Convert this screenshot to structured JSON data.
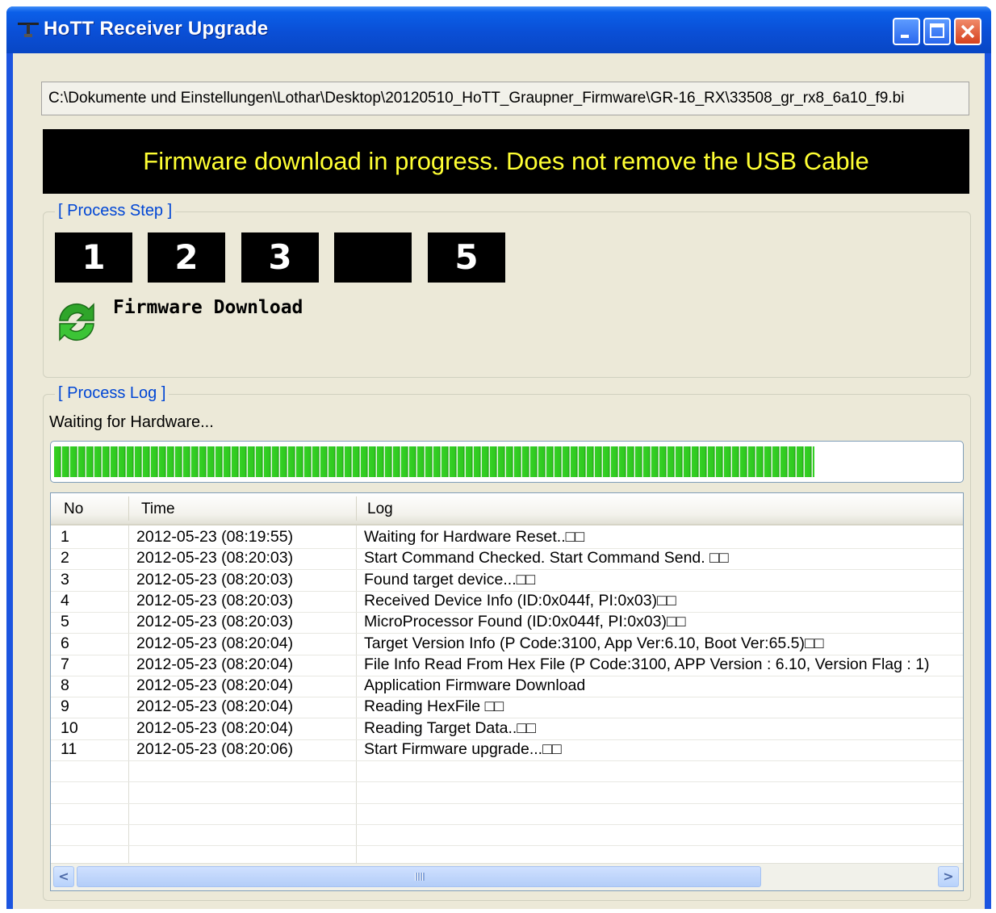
{
  "window": {
    "title": "HoTT Receiver Upgrade"
  },
  "file_path": "C:\\Dokumente und Einstellungen\\Lothar\\Desktop\\20120510_HoTT_Graupner_Firmware\\GR-16_RX\\33508_gr_rx8_6a10_f9.bi",
  "banner_text": "Firmware download in progress. Does not remove the USB Cable",
  "process_step": {
    "legend": "[ Process Step ]",
    "steps": [
      "1",
      "2",
      "3",
      "",
      "5"
    ],
    "current_label": "Firmware Download",
    "icon": "refresh-icon"
  },
  "process_log": {
    "legend": "[ Process Log ]",
    "status": "Waiting for Hardware...",
    "progress_fraction": 0.84,
    "columns": [
      "No",
      "Time",
      "Log"
    ],
    "rows": [
      {
        "no": "1",
        "time": "2012-05-23 (08:19:55)",
        "log": "Waiting for Hardware Reset..□□"
      },
      {
        "no": "2",
        "time": "2012-05-23 (08:20:03)",
        "log": "Start Command Checked. Start Command Send. □□"
      },
      {
        "no": "3",
        "time": "2012-05-23 (08:20:03)",
        "log": "Found target device...□□"
      },
      {
        "no": "4",
        "time": "2012-05-23 (08:20:03)",
        "log": "Received Device Info (ID:0x044f, PI:0x03)□□"
      },
      {
        "no": "5",
        "time": "2012-05-23 (08:20:03)",
        "log": "MicroProcessor Found (ID:0x044f, PI:0x03)□□"
      },
      {
        "no": "6",
        "time": "2012-05-23 (08:20:04)",
        "log": "Target Version Info (P Code:3100, App Ver:6.10, Boot Ver:65.5)□□"
      },
      {
        "no": "7",
        "time": "2012-05-23 (08:20:04)",
        "log": "File Info Read From Hex File (P Code:3100, APP Version : 6.10, Version Flag : 1)"
      },
      {
        "no": "8",
        "time": "2012-05-23 (08:20:04)",
        "log": "Application Firmware Download"
      },
      {
        "no": "9",
        "time": "2012-05-23 (08:20:04)",
        "log": "Reading HexFile □□"
      },
      {
        "no": "10",
        "time": "2012-05-23 (08:20:04)",
        "log": "Reading Target Data..□□"
      },
      {
        "no": "11",
        "time": "2012-05-23 (08:20:06)",
        "log": "Start Firmware upgrade...□□"
      }
    ]
  },
  "scrollbar": {
    "left_arrow": "<",
    "right_arrow": ">"
  }
}
